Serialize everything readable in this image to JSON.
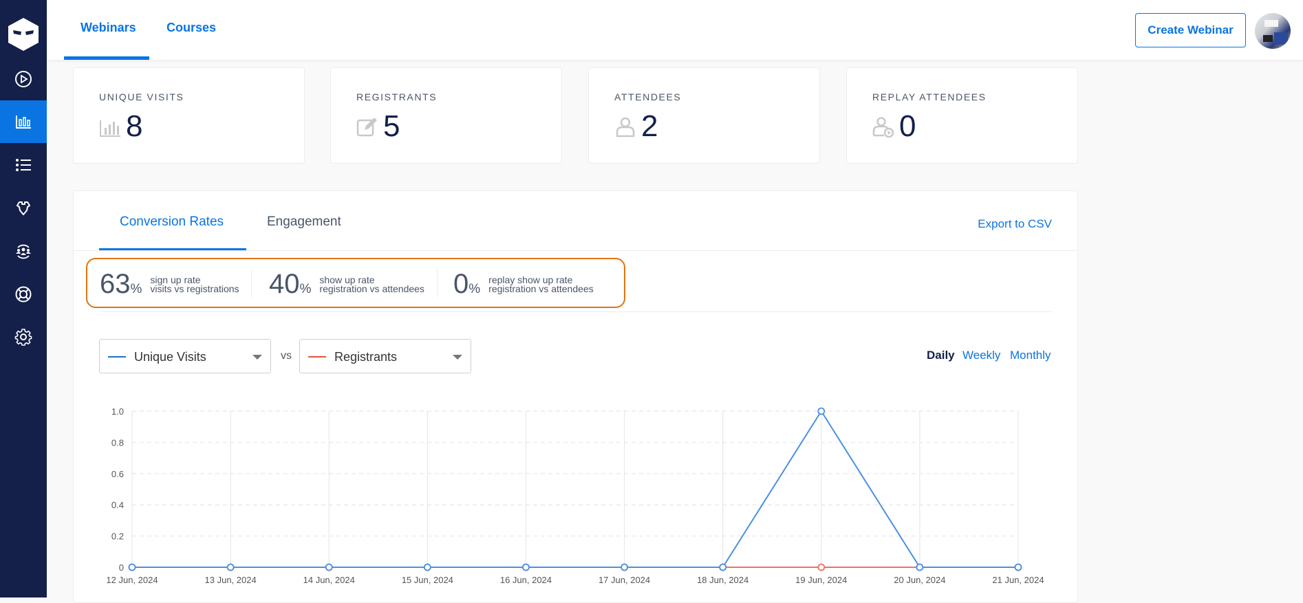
{
  "sidebar": {
    "items": [
      {
        "name": "play-circle-icon",
        "active": false
      },
      {
        "name": "analytics-icon",
        "active": true
      },
      {
        "name": "list-icon",
        "active": false
      },
      {
        "name": "integrations-icon",
        "active": false
      },
      {
        "name": "users-icon",
        "active": false
      },
      {
        "name": "support-icon",
        "active": false
      },
      {
        "name": "settings-icon",
        "active": false
      }
    ]
  },
  "header": {
    "tabs": [
      {
        "label": "Webinars",
        "active": true
      },
      {
        "label": "Courses",
        "active": false
      }
    ],
    "create_button": "Create Webinar"
  },
  "stats": [
    {
      "label": "UNIQUE VISITS",
      "value": "8",
      "icon": "bar-chart-icon"
    },
    {
      "label": "REGISTRANTS",
      "value": "5",
      "icon": "edit-icon"
    },
    {
      "label": "ATTENDEES",
      "value": "2",
      "icon": "user-icon"
    },
    {
      "label": "REPLAY ATTENDEES",
      "value": "0",
      "icon": "user-replay-icon"
    }
  ],
  "panel": {
    "tabs": [
      {
        "label": "Conversion Rates",
        "active": true
      },
      {
        "label": "Engagement",
        "active": false
      }
    ],
    "export_label": "Export to CSV",
    "rates": [
      {
        "value": "63",
        "unit": "%",
        "title": "sign up rate",
        "subtitle": "visits vs registrations"
      },
      {
        "value": "40",
        "unit": "%",
        "title": "show up rate",
        "subtitle": "registration vs attendees"
      },
      {
        "value": "0",
        "unit": "%",
        "title": "replay show up rate",
        "subtitle": "registration vs attendees"
      }
    ],
    "compare": {
      "left": {
        "label": "Unique Visits",
        "color": "#1f6fd6"
      },
      "vs": "vs",
      "right": {
        "label": "Registrants",
        "color": "#e8503a"
      }
    },
    "periods": [
      {
        "label": "Daily",
        "active": true
      },
      {
        "label": "Weekly",
        "active": false
      },
      {
        "label": "Monthly",
        "active": false
      }
    ]
  },
  "chart_data": {
    "type": "line",
    "x": [
      "12 Jun, 2024",
      "13 Jun, 2024",
      "14 Jun, 2024",
      "15 Jun, 2024",
      "16 Jun, 2024",
      "17 Jun, 2024",
      "18 Jun, 2024",
      "19 Jun, 2024",
      "20 Jun, 2024",
      "21 Jun, 2024"
    ],
    "series": [
      {
        "name": "Unique Visits",
        "color": "#4a90e2",
        "values": [
          0,
          0,
          0,
          0,
          0,
          0,
          0,
          1,
          0,
          0
        ]
      },
      {
        "name": "Registrants",
        "color": "#f07060",
        "values": [
          0,
          0,
          0,
          0,
          0,
          0,
          0,
          0,
          0,
          0
        ]
      }
    ],
    "yticks": [
      "0",
      "0.2",
      "0.4",
      "0.6",
      "0.8",
      "1.0"
    ],
    "ylim": [
      0,
      1
    ],
    "grid": true,
    "title": "",
    "xlabel": "",
    "ylabel": ""
  }
}
